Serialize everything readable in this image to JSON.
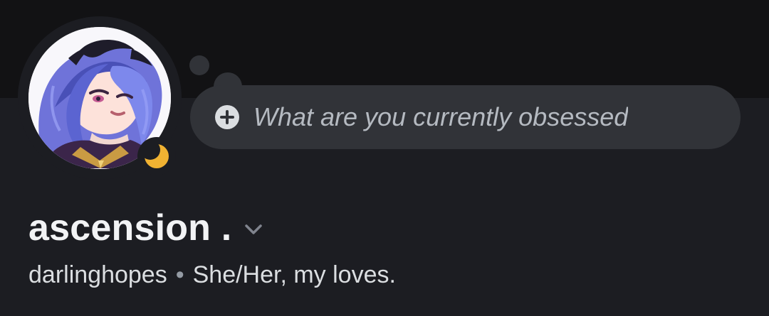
{
  "profile": {
    "display_name": "ascension .",
    "username": "darlinghopes",
    "separator": "•",
    "pronouns": "She/Her, my loves.",
    "status": "idle"
  },
  "custom_status": {
    "placeholder": "What are you currently obsessed"
  },
  "icons": {
    "add_status": "plus-circle-icon",
    "name_menu": "chevron-down-icon",
    "status": "moon-icon"
  },
  "colors": {
    "background": "#1c1d22",
    "banner": "#121214",
    "bubble": "#313338",
    "idle_status": "#f0b232",
    "muted_text": "#b5bac1",
    "primary_text": "#f2f3f5",
    "secondary_text": "#dbdee1"
  }
}
